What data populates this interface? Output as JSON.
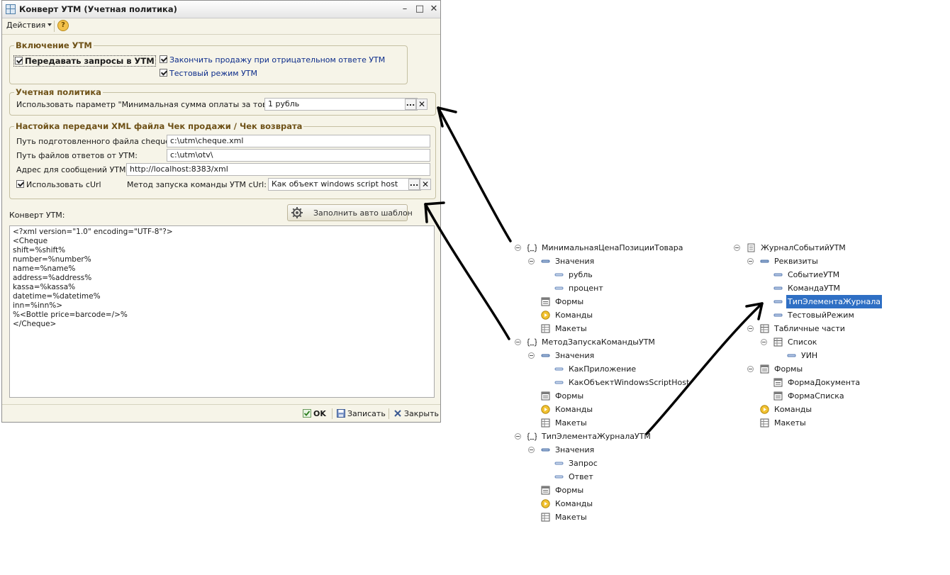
{
  "window": {
    "title": "Конверт УТМ (Учетная политика)",
    "toolbar": {
      "actions": "Действия",
      "help": "?"
    },
    "group_enable": {
      "legend": "Включение УТМ",
      "transmit": {
        "label": "Передавать запросы в УТМ",
        "checked": true
      },
      "finish_sale": {
        "label": "Закончить продажу при отрицательном ответе УТМ",
        "checked": true
      },
      "test_mode": {
        "label": "Тестовый режим УТМ",
        "checked": true
      }
    },
    "group_policy": {
      "legend": "Учетная политика",
      "param_label": "Использовать параметр \"Минимальная сумма оплаты за товар:\"",
      "param_value": "1 рубль"
    },
    "group_xml": {
      "legend": "Настойка передачи XML файла Чек продажи / Чек возврата",
      "cheque_path_label": "Путь подготовленного файла cheque.xml:",
      "cheque_path_value": "c:\\utm\\cheque.xml",
      "answers_path_label": "Путь файлов ответов от УТМ:",
      "answers_path_value": "c:\\utm\\otv\\",
      "address_label": "Адрес для сообщений УТМ:",
      "address_value": "http://localhost:8383/xml",
      "use_curl": {
        "label": "Использовать cUrl",
        "checked": true
      },
      "curl_method_label": "Метод запуска команды УТМ cUrl:",
      "curl_method_value": "Как объект windows script host"
    },
    "envelope_label": "Конверт УТМ:",
    "fill_button": "Заполнить авто шаблон",
    "xml_lines": [
      "<?xml version=\"1.0\" encoding=\"UTF-8\"?>",
      "<Cheque",
      "shift=%shift%",
      "number=%number%",
      "name=%name%",
      "address=%address%",
      "kassa=%kassa%",
      "datetime=%datetime%",
      "inn=%inn%>",
      "%<Bottle price=barcode=/>%",
      "</Cheque>"
    ],
    "bottom": {
      "ok": "OK",
      "save": "Записать",
      "close": "Закрыть"
    }
  },
  "tree_left": [
    {
      "label": "МинимальнаяЦенаПозицииТовара",
      "icon": "enum-icon",
      "level": 0,
      "toggle": true
    },
    {
      "label": "Значения",
      "icon": "values-icon",
      "level": 1,
      "toggle": true
    },
    {
      "label": "рубль",
      "icon": "value-item-icon",
      "level": 2,
      "toggle": false
    },
    {
      "label": "процент",
      "icon": "value-item-icon",
      "level": 2,
      "toggle": false
    },
    {
      "label": "Формы",
      "icon": "form-icon",
      "level": 1,
      "toggle": false
    },
    {
      "label": "Команды",
      "icon": "command-icon",
      "level": 1,
      "toggle": false
    },
    {
      "label": "Макеты",
      "icon": "layout-icon",
      "level": 1,
      "toggle": false
    },
    {
      "label": "МетодЗапускаКомандыУТМ",
      "icon": "enum-icon",
      "level": 0,
      "toggle": true
    },
    {
      "label": "Значения",
      "icon": "values-icon",
      "level": 1,
      "toggle": true
    },
    {
      "label": "КакПриложение",
      "icon": "value-item-icon",
      "level": 2,
      "toggle": false
    },
    {
      "label": "КакОбъектWindowsScriptHost",
      "icon": "value-item-icon",
      "level": 2,
      "toggle": false
    },
    {
      "label": "Формы",
      "icon": "form-icon",
      "level": 1,
      "toggle": false
    },
    {
      "label": "Команды",
      "icon": "command-icon",
      "level": 1,
      "toggle": false
    },
    {
      "label": "Макеты",
      "icon": "layout-icon",
      "level": 1,
      "toggle": false
    },
    {
      "label": "ТипЭлементаЖурналаУТМ",
      "icon": "enum-icon",
      "level": 0,
      "toggle": true
    },
    {
      "label": "Значения",
      "icon": "values-icon",
      "level": 1,
      "toggle": true
    },
    {
      "label": "Запрос",
      "icon": "value-item-icon",
      "level": 2,
      "toggle": false
    },
    {
      "label": "Ответ",
      "icon": "value-item-icon",
      "level": 2,
      "toggle": false
    },
    {
      "label": "Формы",
      "icon": "form-icon",
      "level": 1,
      "toggle": false
    },
    {
      "label": "Команды",
      "icon": "command-icon",
      "level": 1,
      "toggle": false
    },
    {
      "label": "Макеты",
      "icon": "layout-icon",
      "level": 1,
      "toggle": false
    }
  ],
  "tree_right": [
    {
      "label": "ЖурналСобытийУТМ",
      "icon": "document-icon",
      "level": 0,
      "toggle": true
    },
    {
      "label": "Реквизиты",
      "icon": "attributes-icon",
      "level": 1,
      "toggle": true
    },
    {
      "label": "СобытиеУТМ",
      "icon": "attribute-icon",
      "level": 2,
      "toggle": false
    },
    {
      "label": "КомандаУТМ",
      "icon": "attribute-icon",
      "level": 2,
      "toggle": false
    },
    {
      "label": "ТипЭлементаЖурнала",
      "icon": "attribute-icon",
      "level": 2,
      "toggle": false,
      "selected": true
    },
    {
      "label": "ТестовыйРежим",
      "icon": "attribute-icon",
      "level": 2,
      "toggle": false
    },
    {
      "label": "Табличные части",
      "icon": "table-icon",
      "level": 1,
      "toggle": true
    },
    {
      "label": "Список",
      "icon": "table-icon",
      "level": 2,
      "toggle": true
    },
    {
      "label": "УИН",
      "icon": "attribute-icon",
      "level": 3,
      "toggle": false
    },
    {
      "label": "Формы",
      "icon": "form-icon",
      "level": 1,
      "toggle": true
    },
    {
      "label": "ФормаДокумента",
      "icon": "form-icon",
      "level": 2,
      "toggle": false
    },
    {
      "label": "ФормаСписка",
      "icon": "form-icon",
      "level": 2,
      "toggle": false
    },
    {
      "label": "Команды",
      "icon": "command-icon",
      "level": 1,
      "toggle": false
    },
    {
      "label": "Макеты",
      "icon": "layout-icon",
      "level": 1,
      "toggle": false
    }
  ],
  "colors": {
    "accent": "#0c2c8a",
    "legend": "#6f5218",
    "selection": "#2f6fc4",
    "window_bg": "#f6f4e8"
  }
}
